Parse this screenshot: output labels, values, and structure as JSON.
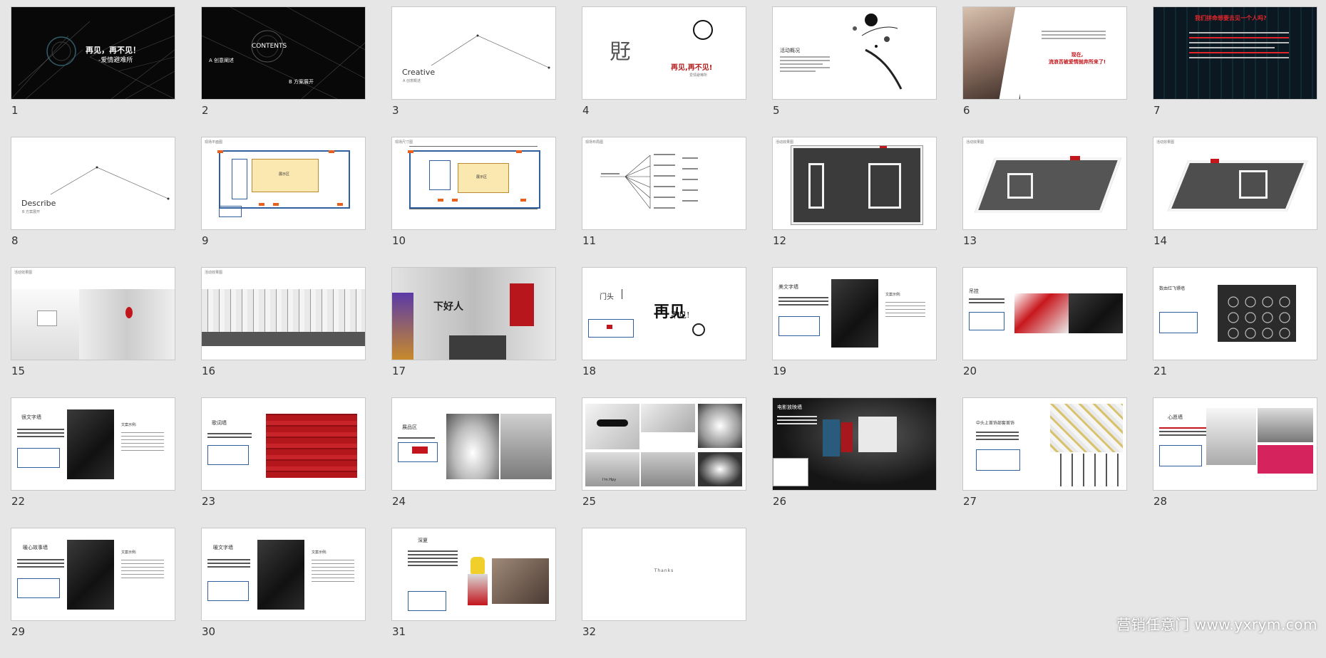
{
  "slides": [
    {
      "number": "1",
      "title": "再见，再不见！",
      "subtitle": "-爱情避难所"
    },
    {
      "number": "2",
      "title": "CONTENTS",
      "item_a": "A 创意阐述",
      "item_b": "B 方案展开"
    },
    {
      "number": "3",
      "title": "Creative",
      "subtitle": "A 创意概述"
    },
    {
      "number": "4",
      "glyph": "覎",
      "title": "再见,再不见!",
      "subtitle": "爱情避难所"
    },
    {
      "number": "5",
      "heading": "活动概况"
    },
    {
      "number": "6",
      "red_text": "现在,\n流浪否被爱情抛弃所来了!"
    },
    {
      "number": "7",
      "red_title": "我们拼命想要去见一个人吗?"
    },
    {
      "number": "8",
      "title": "Describe",
      "subtitle": "B 方案展开"
    },
    {
      "number": "9",
      "heading": "现场平面图",
      "center_label": "展示区"
    },
    {
      "number": "10",
      "heading": "现场尺寸图",
      "center_label": "展示区"
    },
    {
      "number": "11",
      "heading": "现场布局图"
    },
    {
      "number": "12",
      "heading": "活动效果图"
    },
    {
      "number": "13",
      "heading": "活动效果图"
    },
    {
      "number": "14",
      "heading": "活动效果图"
    },
    {
      "number": "15",
      "heading": "活动效果图"
    },
    {
      "number": "16",
      "heading": "活动效果图"
    },
    {
      "number": "17",
      "wall_text": "下好人"
    },
    {
      "number": "18",
      "heading": "门头",
      "big": "再见",
      "big2": "不见!"
    },
    {
      "number": "19",
      "heading": "美文字墙",
      "side": "文案示例:"
    },
    {
      "number": "20",
      "heading": "吊挂"
    },
    {
      "number": "21",
      "heading": "数由红飞镖墙"
    },
    {
      "number": "22",
      "heading": "很文字墙",
      "side": "文案示例:"
    },
    {
      "number": "23",
      "heading": "歌词墙"
    },
    {
      "number": "24",
      "heading": "展品区"
    },
    {
      "number": "25",
      "caption": "I'm Hpy"
    },
    {
      "number": "26",
      "heading": "电影放映墙"
    },
    {
      "number": "27",
      "heading": "中头上首饰部套首饰"
    },
    {
      "number": "28",
      "heading": "心愿墙"
    },
    {
      "number": "29",
      "heading": "暖心故事墙",
      "side": "文案示例:"
    },
    {
      "number": "30",
      "heading": "暖文字墙",
      "side": "文案示例:"
    },
    {
      "number": "31",
      "heading": "深夏"
    },
    {
      "number": "32",
      "text": "Thanks"
    }
  ],
  "watermark": "营销任意门 www.yxrym.com"
}
